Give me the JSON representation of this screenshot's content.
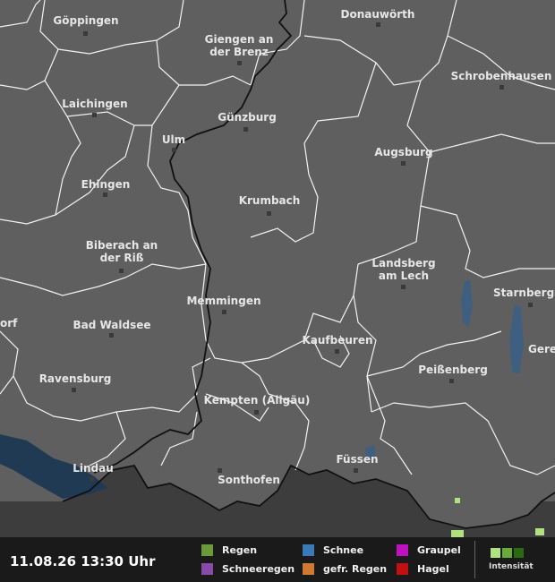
{
  "map": {
    "cities": [
      {
        "id": "goeppingen",
        "name": "Göppingen"
      },
      {
        "id": "donauwoerth",
        "name": "Donauwörth"
      },
      {
        "id": "giengen",
        "name_lines": [
          "Giengen an",
          "der Brenz"
        ]
      },
      {
        "id": "schrobenhausen",
        "name": "Schrobenhausen"
      },
      {
        "id": "laichingen",
        "name": "Laichingen"
      },
      {
        "id": "guenzburg",
        "name": "Günzburg"
      },
      {
        "id": "ulm",
        "name": "Ulm"
      },
      {
        "id": "augsburg",
        "name": "Augsburg"
      },
      {
        "id": "ehingen",
        "name": "Ehingen"
      },
      {
        "id": "krumbach",
        "name": "Krumbach"
      },
      {
        "id": "biberach",
        "name_lines": [
          "Biberach an",
          "der Riß"
        ]
      },
      {
        "id": "landsberg",
        "name_lines": [
          "Landsberg",
          "am Lech"
        ]
      },
      {
        "id": "starnberg",
        "name": "Starnberg"
      },
      {
        "id": "memmingen",
        "name": "Memmingen"
      },
      {
        "id": "orf",
        "name": "orf"
      },
      {
        "id": "bad-waldsee",
        "name": "Bad Waldsee"
      },
      {
        "id": "kaufbeuren",
        "name": "Kaufbeuren"
      },
      {
        "id": "gere",
        "name": "Gere"
      },
      {
        "id": "peissenberg",
        "name": "Peißenberg"
      },
      {
        "id": "ravensburg",
        "name": "Ravensburg"
      },
      {
        "id": "kempten",
        "name": "Kempten (Allgäu)"
      },
      {
        "id": "fuessen",
        "name": "Füssen"
      },
      {
        "id": "lindau",
        "name": "Lindau"
      },
      {
        "id": "sonthofen",
        "name": "Sonthofen"
      }
    ]
  },
  "legend": {
    "timestamp": "11.08.26 13:30 Uhr",
    "items": [
      {
        "label": "Regen",
        "color": "#6a9a3a"
      },
      {
        "label": "Schnee",
        "color": "#3a7ab8"
      },
      {
        "label": "Graupel",
        "color": "#c010c0"
      },
      {
        "label": "Schneeregen",
        "color": "#8a4aaa"
      },
      {
        "label": "gefr. Regen",
        "color": "#d07a30"
      },
      {
        "label": "Hagel",
        "color": "#c01010"
      }
    ],
    "intensity_label": "Intensität",
    "intensity_colors": [
      "#b0e080",
      "#6aaa3a",
      "#2a6a10"
    ]
  },
  "colors": {
    "land": "#5f5f5f",
    "outside_area": "#3d3d3d",
    "water": "#1f3a52",
    "lake": "#3f5f80",
    "precip_light": "#b0e080"
  }
}
